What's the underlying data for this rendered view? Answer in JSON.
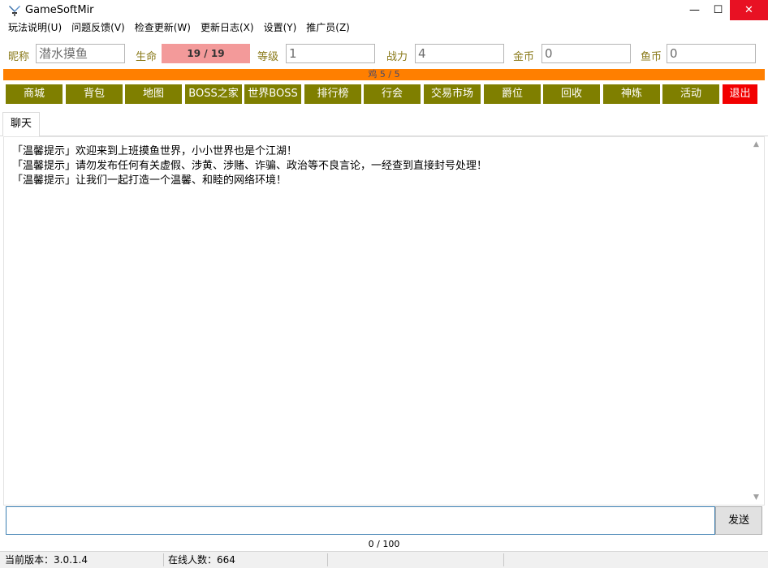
{
  "window": {
    "title": "GameSoftMir",
    "minimize": "—",
    "maximize": "☐",
    "close": "✕",
    "accent_close": "#e81123"
  },
  "menu": [
    "玩法说明(U)",
    "问题反馈(V)",
    "检查更新(W)",
    "更新日志(X)",
    "设置(Y)",
    "推广员(Z)"
  ],
  "stats": {
    "nickname_label": "昵称",
    "nickname_value": "潜水摸鱼",
    "hp_label": "生命",
    "hp_value": "19 / 19",
    "level_label": "等级",
    "level_value": "1",
    "power_label": "战力",
    "power_value": "4",
    "gold_label": "金币",
    "gold_value": "0",
    "fishcoin_label": "鱼币",
    "fishcoin_value": "0"
  },
  "progress": {
    "text": "鸡 5 / 5",
    "fraction": 1.0,
    "color": "#ff7f00"
  },
  "buttons": [
    "商城",
    "背包",
    "地图",
    "BOSS之家",
    "世界BOSS",
    "排行榜",
    "行会",
    "交易市场",
    "爵位",
    "回收",
    "神炼",
    "活动",
    "退出"
  ],
  "button_color": "#7f7f00",
  "exit_color": "#f20000",
  "tab": "聊天",
  "chat": [
    "「温馨提示」欢迎来到上班摸鱼世界，小小世界也是个江湖！",
    "「温馨提示」请勿发布任何有关虚假、涉黄、涉赌、诈骗、政治等不良言论，一经查到直接封号处理！",
    "「温馨提示」让我们一起打造一个温馨、和睦的网络环境！"
  ],
  "input": {
    "value": "",
    "send_label": "发送",
    "char_count": "0 / 100"
  },
  "status": {
    "version": "当前版本：3.0.1.4",
    "online": "在线人数：664"
  }
}
